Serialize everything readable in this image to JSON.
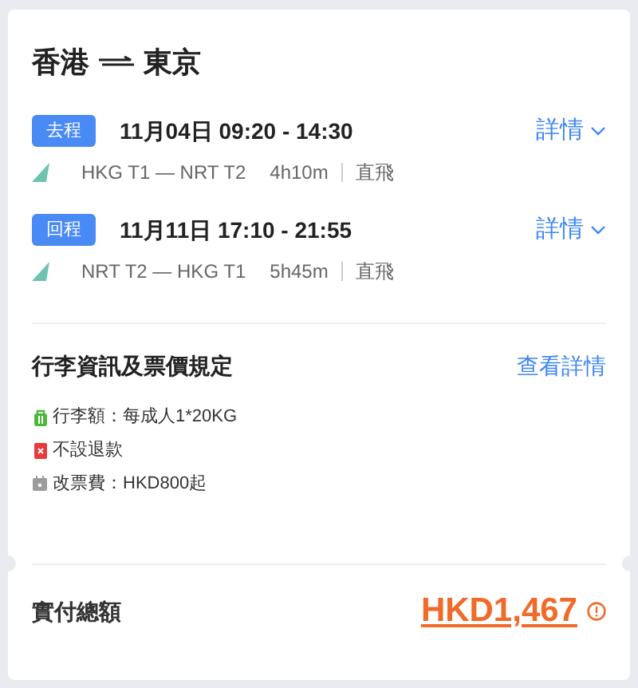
{
  "title": {
    "from": "香港",
    "to": "東京"
  },
  "segments": [
    {
      "tag": "去程",
      "datetime": "11月04日 09:20 - 14:30",
      "route": "HKG T1 — NRT T2",
      "duration": "4h10m",
      "stops": "直飛",
      "details": "詳情"
    },
    {
      "tag": "回程",
      "datetime": "11月11日 17:10 - 21:55",
      "route": "NRT T2 — HKG T1",
      "duration": "5h45m",
      "stops": "直飛",
      "details": "詳情"
    }
  ],
  "rules": {
    "heading": "行李資訊及票價規定",
    "link": "查看詳情",
    "items": [
      {
        "kind": "baggage",
        "text": "行李額：每成人1*20KG"
      },
      {
        "kind": "refund",
        "text": "不設退款"
      },
      {
        "kind": "change",
        "text": "改票費：HKD800起"
      }
    ]
  },
  "total": {
    "label": "實付總額",
    "amount": "HKD1,467"
  }
}
